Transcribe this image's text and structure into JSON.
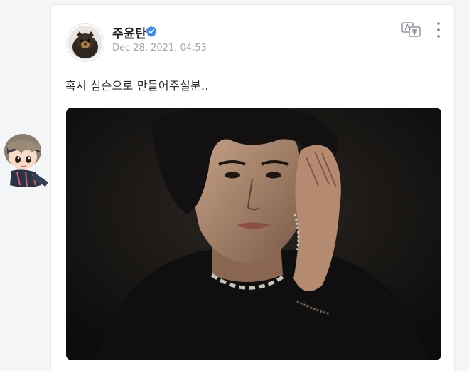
{
  "post": {
    "author_name": "주윤탄",
    "date": "Dec 28, 2021, 04:53",
    "text": "혹시 심슨으로 만들어주실분.."
  },
  "colors": {
    "verified": "#3b8bea",
    "date_text": "#a2a6ad",
    "card_background": "#ffffff",
    "page_background": "#f4f5f7"
  },
  "icons": {
    "verified": "verified-badge-icon",
    "translate": "translate-icon",
    "more": "more-options-icon"
  }
}
